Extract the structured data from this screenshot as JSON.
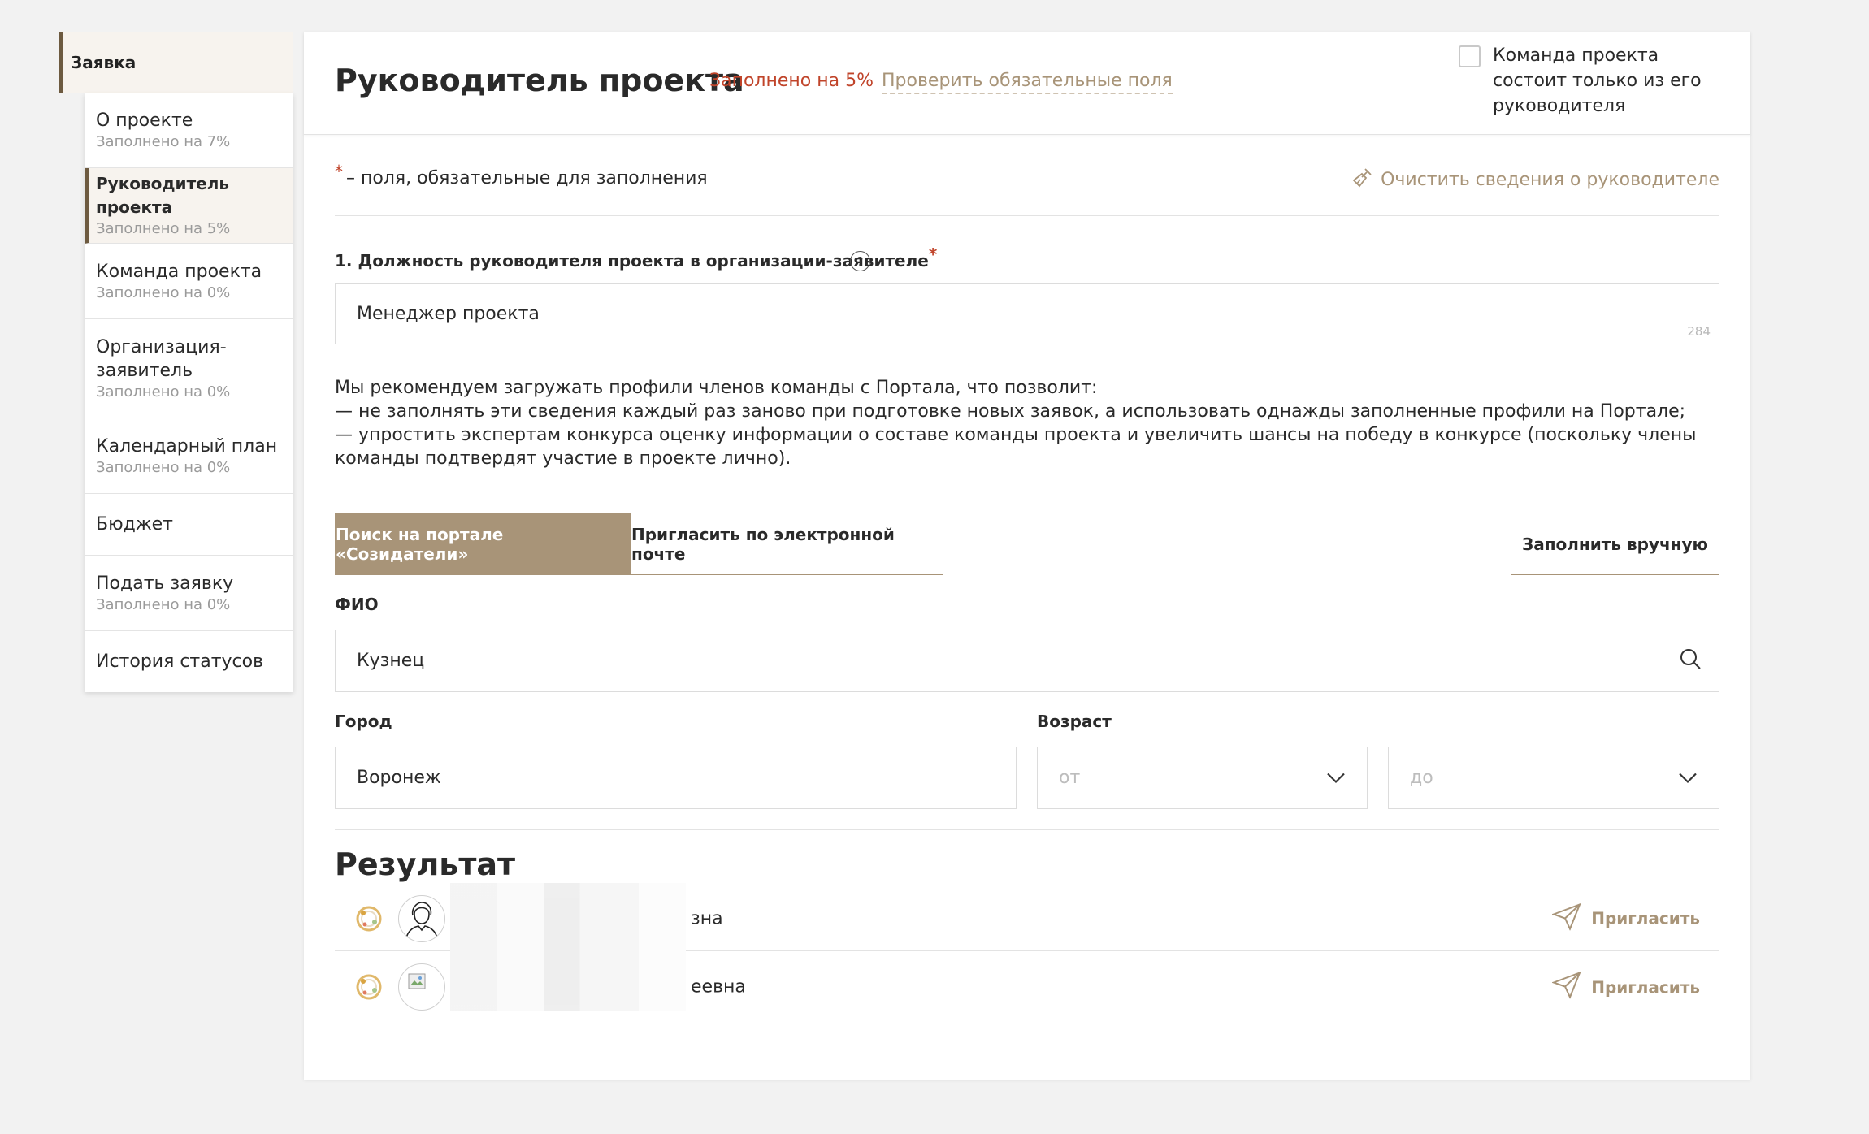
{
  "sidebar": {
    "header": "Заявка",
    "items": [
      {
        "label": "О проекте",
        "sub": "Заполнено на 7%"
      },
      {
        "label": "Руководитель проекта",
        "sub": "Заполнено на 5%"
      },
      {
        "label": "Команда проекта",
        "sub": "Заполнено на 0%"
      },
      {
        "label": "Организация-заявитель",
        "sub": "Заполнено на 0%"
      },
      {
        "label": "Календарный план",
        "sub": "Заполнено на 0%"
      },
      {
        "label": "Бюджет",
        "sub": ""
      },
      {
        "label": "Подать заявку",
        "sub": "Заполнено на 0%"
      },
      {
        "label": "История статусов",
        "sub": ""
      }
    ]
  },
  "header": {
    "title": "Руководитель проекта",
    "fill_status": "Заполнено на 5%",
    "check_link": "Проверить обязательные поля",
    "team_checkbox_label": "Команда проекта состоит только из его руководителя"
  },
  "form": {
    "required_star": "*",
    "required_note": "– поля, обязательные для заполнения",
    "clear_link": "Очистить сведения о руководителе",
    "position_label": "1. Должность руководителя проекта в организации-заявителе",
    "position_value": "Менеджер проекта",
    "position_counter": "284",
    "recommend_lines": [
      "Мы рекомендуем загружать профили членов команды с Портала, что позволит:",
      "— не заполнять эти сведения каждый раз заново при подготовке новых заявок, а использовать однажды заполненные профили на Портале;",
      "— упростить экспертам конкурса оценку информации о составе команды проекта и увеличить шансы на победу в конкурсе (поскольку члены команды подтвердят участие в проекте лично)."
    ],
    "tab_portal": "Поиск на портале «Созидатели»",
    "tab_email": "Пригласить по электронной почте",
    "manual_button": "Заполнить вручную",
    "fio_label": "ФИО",
    "fio_value": "Кузнец",
    "city_label": "Город",
    "city_value": "Воронеж",
    "age_label": "Возраст",
    "age_from_placeholder": "от",
    "age_to_placeholder": "до"
  },
  "results": {
    "title": "Результат",
    "rows": [
      {
        "name_tail": "зна",
        "invite_label": "Пригласить"
      },
      {
        "name_tail": "еевна",
        "invite_label": "Пригласить"
      }
    ]
  },
  "colors": {
    "accent": "#a89478",
    "accent_dark": "#6d5a40",
    "warning": "#c0442a"
  }
}
